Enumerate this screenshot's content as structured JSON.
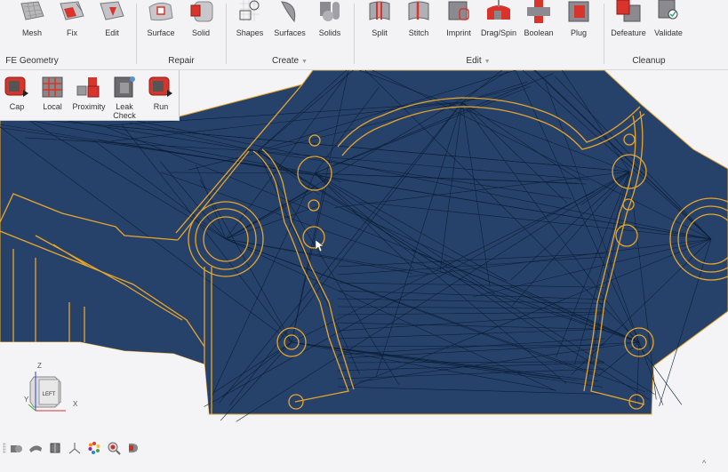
{
  "ribbon": {
    "groups": [
      {
        "label": "FE Geometry",
        "has_menu": false
      },
      {
        "label": "Repair",
        "has_menu": false
      },
      {
        "label": "Create",
        "has_menu": true
      },
      {
        "label": "Edit",
        "has_menu": true
      },
      {
        "label": "Cleanup",
        "has_menu": false
      }
    ],
    "tools": {
      "mesh": "Mesh",
      "fix": "Fix",
      "edit_fe": "Edit",
      "surface": "Surface",
      "solid": "Solid",
      "shapes": "Shapes",
      "surfaces": "Surfaces",
      "solids": "Solids",
      "split": "Split",
      "stitch": "Stitch",
      "imprint": "Imprint",
      "dragspin": "Drag/Spin",
      "boolean": "Boolean",
      "plug": "Plug",
      "defeature": "Defeature",
      "validate": "Validate"
    },
    "menu_caret": "▼"
  },
  "repair_panel": {
    "tools": {
      "cap": "Cap",
      "local": "Local",
      "proximity": "Proximity",
      "leak_check_1": "Leak",
      "leak_check_2": "Check",
      "run": "Run"
    }
  },
  "viewport": {
    "model_fill": "#26426b",
    "edge_color": "#e8a52a",
    "mesh_line": "#0d1f38",
    "view_cube_face": "LEFT",
    "axes": {
      "x": "X",
      "y": "Y",
      "z": "Z"
    }
  },
  "bottom_toolbar": {
    "icons": [
      "view-icon",
      "shaded-icon",
      "cube-icon",
      "axis-icon",
      "color-wheel-icon",
      "zoom-icon",
      "section-icon"
    ]
  },
  "scroll_up": "^"
}
